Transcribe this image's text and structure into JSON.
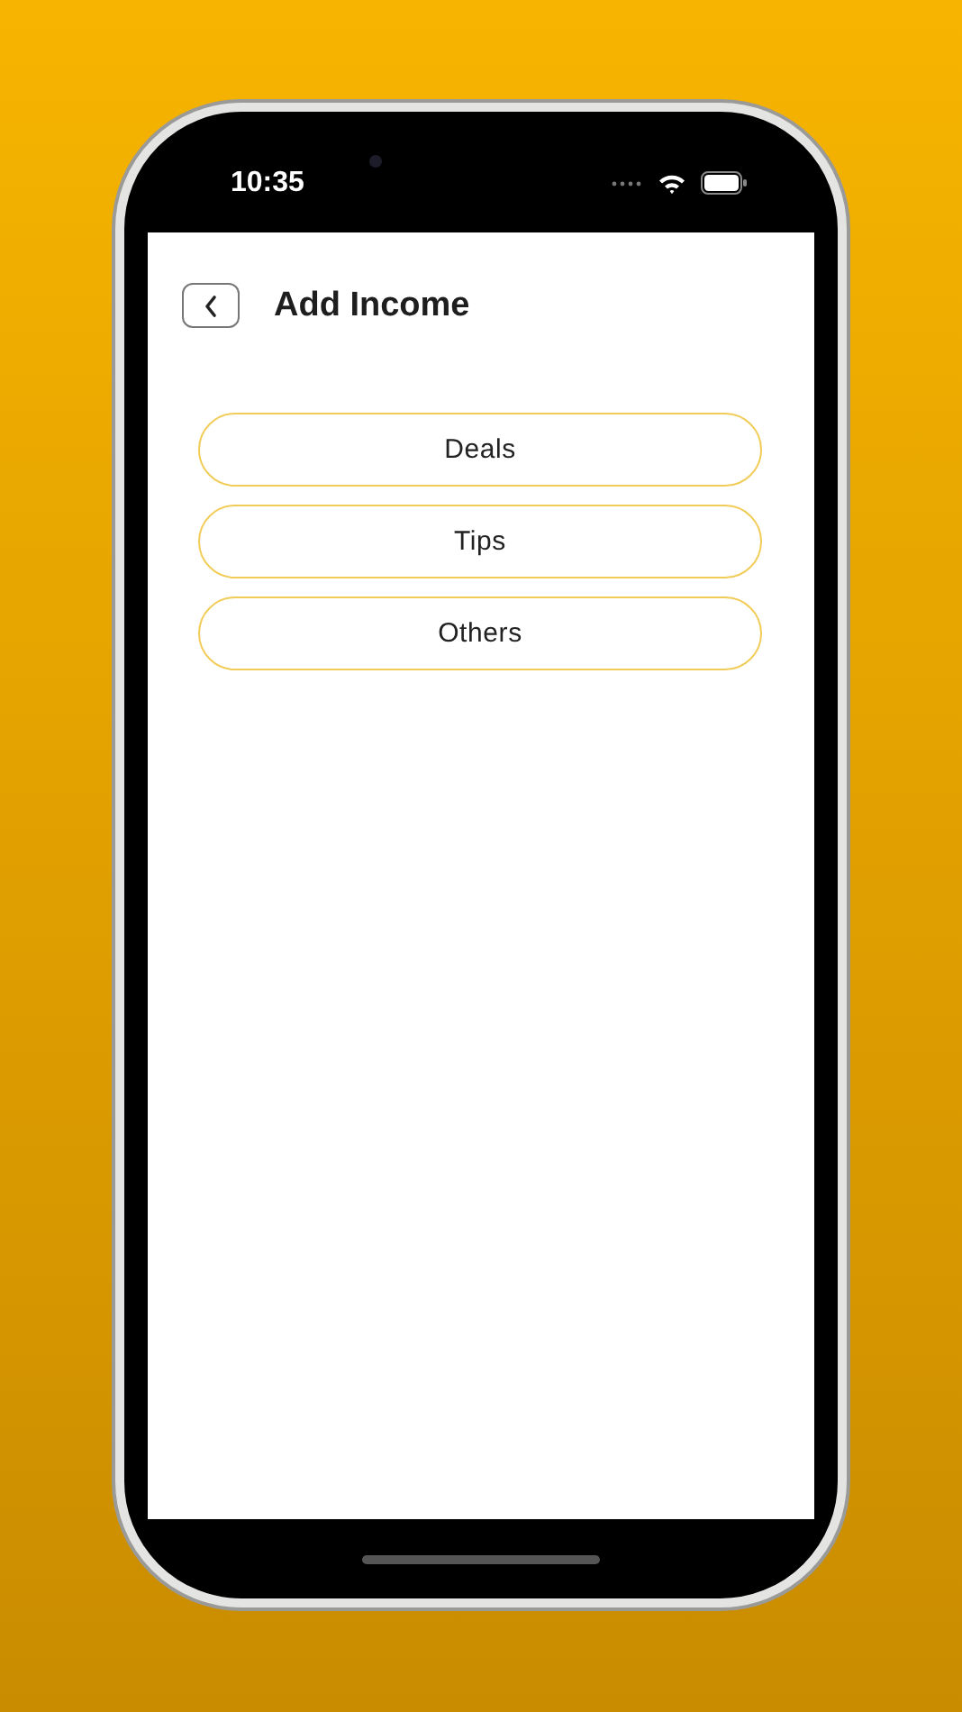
{
  "status_bar": {
    "time": "10:35"
  },
  "header": {
    "title": "Add Income"
  },
  "options": [
    {
      "label": "Deals"
    },
    {
      "label": "Tips"
    },
    {
      "label": "Others"
    }
  ]
}
